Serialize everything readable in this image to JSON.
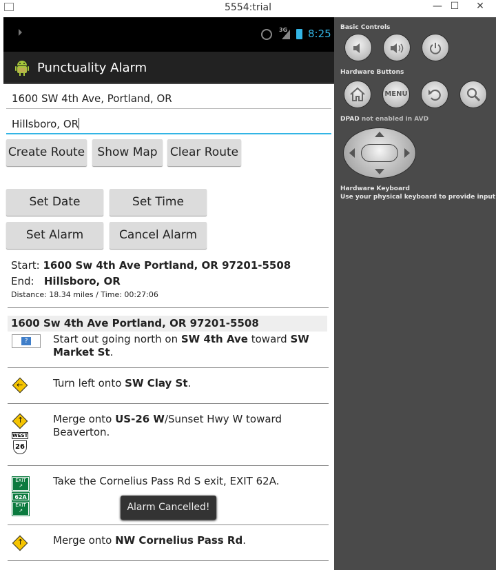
{
  "window": {
    "title": "5554:trial",
    "controls": {
      "minimize": "—",
      "maximize": "☐",
      "close": "✕"
    }
  },
  "statusbar": {
    "network": "3G",
    "time": "8:25"
  },
  "actionbar": {
    "title": "Punctuality Alarm"
  },
  "inputs": {
    "start": {
      "value": "1600 SW 4th Ave, Portland, OR"
    },
    "end": {
      "value": "Hillsboro, OR"
    }
  },
  "route_buttons": {
    "create": "Create Route",
    "show_map": "Show Map",
    "clear": "Clear Route"
  },
  "alarm_buttons": {
    "set_date": "Set Date",
    "set_time": "Set Time",
    "set_alarm": "Set Alarm",
    "cancel_alarm": "Cancel Alarm"
  },
  "summary": {
    "start_label": "Start:",
    "start_value": "1600 Sw 4th Ave Portland, OR 97201-5508",
    "end_label": "End:",
    "end_value": "Hillsboro, OR",
    "distance": "Distance: 18.34 miles / Time: 00:27:06"
  },
  "directions": {
    "start_header": "1600 Sw 4th Ave Portland, OR 97201-5508",
    "steps": [
      {
        "pre": "Start out going north on ",
        "b1": "SW 4th Ave",
        "mid": " toward ",
        "b2": "SW Market St",
        "post": "."
      },
      {
        "pre": "Turn left onto ",
        "b1": "SW Clay St",
        "post": "."
      },
      {
        "pre": "Merge onto ",
        "b1": "US-26 W",
        "post": "/Sunset Hwy W toward Beaverton."
      },
      {
        "pre": "Take the Cornelius Pass Rd S exit, EXIT 62A."
      },
      {
        "pre": "Merge onto ",
        "b1": "NW Cornelius Pass Rd",
        "post": "."
      }
    ],
    "shield_west": "WEST",
    "shield_number": "26",
    "exit_text": "EXIT",
    "exit_number": "62A"
  },
  "toast": {
    "text": "Alarm Cancelled!"
  },
  "side_panel": {
    "basic_controls": "Basic Controls",
    "hardware_buttons": "Hardware Buttons",
    "menu_label": "MENU",
    "dpad_label": "DPAD",
    "dpad_note": " not enabled in AVD",
    "keyboard_title": "Hardware Keyboard",
    "keyboard_note": "Use your physical keyboard to provide input"
  },
  "colors": {
    "accent": "#33b5e5",
    "panel": "#4a4a4a",
    "actionbar": "#222222",
    "exit_green": "#0b7a3e"
  }
}
